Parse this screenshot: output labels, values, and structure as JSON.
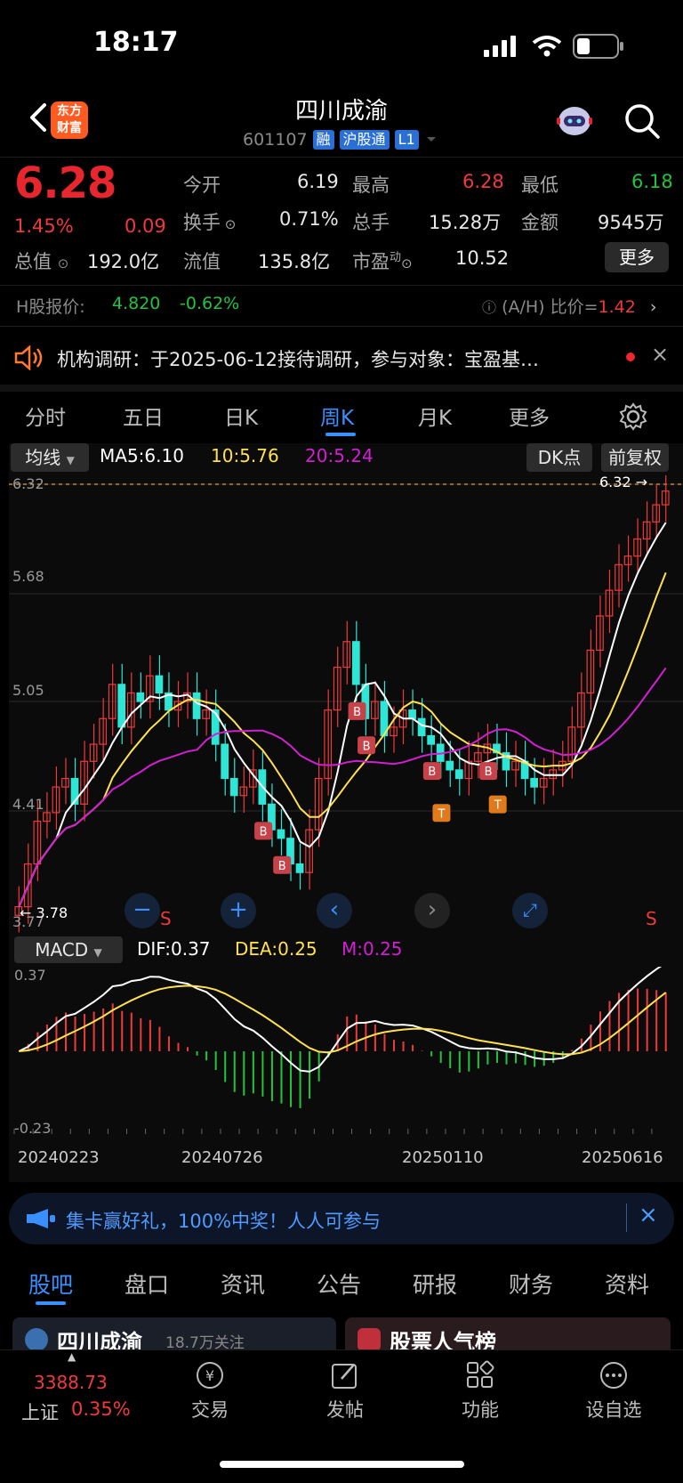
{
  "status_bar": {
    "time": "18:17"
  },
  "header": {
    "app_logo_text": "东方财富",
    "stock_name": "四川成渝",
    "stock_code": "601107",
    "tags": [
      "融",
      "沪股通",
      "L1"
    ]
  },
  "quote": {
    "price": "6.28",
    "change_pct": "1.45%",
    "change_amt": "0.09",
    "total_value_label": "总值",
    "total_value": "192.0亿",
    "rows": [
      [
        {
          "label": "今开",
          "value": "6.19"
        },
        {
          "label": "最高",
          "value": "6.28"
        },
        {
          "label": "最低",
          "value": "6.18"
        }
      ],
      [
        {
          "label": "换手",
          "value": "0.71%"
        },
        {
          "label": "总手",
          "value": "15.28万"
        },
        {
          "label": "金额",
          "value": "9545万"
        }
      ],
      [
        {
          "label": "流值",
          "value": "135.8亿"
        },
        {
          "label": "市盈",
          "value": "10.52"
        }
      ]
    ],
    "pe_superscript": "动",
    "more_label": "更多"
  },
  "h_share": {
    "label": "H股报价:",
    "price": "4.820",
    "change": "-0.62%",
    "ratio_label": "(A/H) 比价=",
    "ratio": "1.42"
  },
  "notice": {
    "text": "机构调研：于2025-06-12接待调研，参与对象：宝盈基…"
  },
  "chart_tabs": {
    "items": [
      "分时",
      "五日",
      "日K",
      "周K",
      "月K",
      "更多"
    ],
    "active": "周K"
  },
  "ma_bar": {
    "selector": "均线",
    "ma5": "MA5:6.10",
    "ma10": "10:5.76",
    "ma20": "20:5.24",
    "dk_label": "DK点",
    "adjust_label": "前复权"
  },
  "macd_bar": {
    "selector": "MACD",
    "dif": "DIF:0.37",
    "dea": "DEA:0.25",
    "m": "M:0.25"
  },
  "colors": {
    "up": "#f03a3a",
    "down": "#2ee6d6",
    "ma5": "#ffffff",
    "ma10": "#ffe14d",
    "ma20": "#d21fd2",
    "accent": "#3a8fff"
  },
  "chart_data": [
    {
      "type": "candlestick",
      "title": "",
      "y_ticks": [
        "6.32",
        "5.68",
        "5.05",
        "4.41",
        "3.77"
      ],
      "ylim": [
        3.77,
        6.32
      ],
      "high_marker": "6.32",
      "low_marker": "3.78",
      "x_labels": [
        "20240223",
        "20240726",
        "20250110",
        "20250616"
      ],
      "markers": [
        "B",
        "B",
        "B",
        "B",
        "B",
        "T",
        "B",
        "T",
        "S",
        "S"
      ],
      "series": [
        {
          "name": "MA5",
          "value": "6.10"
        },
        {
          "name": "10",
          "value": "5.76"
        },
        {
          "name": "20",
          "value": "5.24"
        }
      ],
      "close": [
        3.85,
        4.1,
        4.35,
        4.4,
        4.55,
        4.6,
        4.45,
        4.7,
        4.8,
        4.95,
        5.15,
        4.9,
        5.1,
        5.05,
        5.2,
        5.1,
        5.0,
        5.05,
        5.1,
        4.95,
        5.0,
        4.8,
        4.6,
        4.5,
        4.55,
        4.65,
        4.45,
        4.3,
        4.25,
        4.1,
        4.05,
        4.3,
        4.6,
        5.0,
        5.25,
        5.4,
        5.15,
        4.95,
        5.05,
        4.85,
        4.9,
        5.0,
        4.95,
        4.85,
        4.8,
        4.7,
        4.65,
        4.6,
        4.7,
        4.75,
        4.8,
        4.75,
        4.65,
        4.7,
        4.6,
        4.55,
        4.6,
        4.65,
        4.7,
        4.9,
        5.1,
        5.35,
        5.55,
        5.7,
        5.85,
        5.9,
        6.0,
        6.1,
        6.2,
        6.28
      ]
    },
    {
      "type": "bar",
      "title": "",
      "y_ticks": [
        "0.37",
        "-0.23"
      ],
      "ylim": [
        -0.23,
        0.37
      ],
      "series": [
        {
          "name": "DIF",
          "value": "0.37"
        },
        {
          "name": "DEA",
          "value": "0.25"
        },
        {
          "name": "M",
          "value": "0.25"
        }
      ],
      "x_labels": [
        "20240223",
        "20240726",
        "20250110",
        "20250616"
      ]
    }
  ],
  "controls": [
    "zoom-out",
    "zoom-in",
    "prev",
    "next",
    "fullscreen"
  ],
  "banner": {
    "text": "集卡赢好礼，100%中奖！人人可参与"
  },
  "bottom_tabs": {
    "items": [
      "股吧",
      "盘口",
      "资讯",
      "公告",
      "研报",
      "财务",
      "资料"
    ],
    "active": "股吧"
  },
  "cards": {
    "left": "四川成渝",
    "left_sub": "18.7万关注",
    "right": "股票人气榜"
  },
  "bottom_nav": {
    "index_value": "3388.73",
    "index_name": "上证",
    "index_change": "0.35%",
    "items": [
      "交易",
      "发帖",
      "功能",
      "设自选"
    ]
  }
}
